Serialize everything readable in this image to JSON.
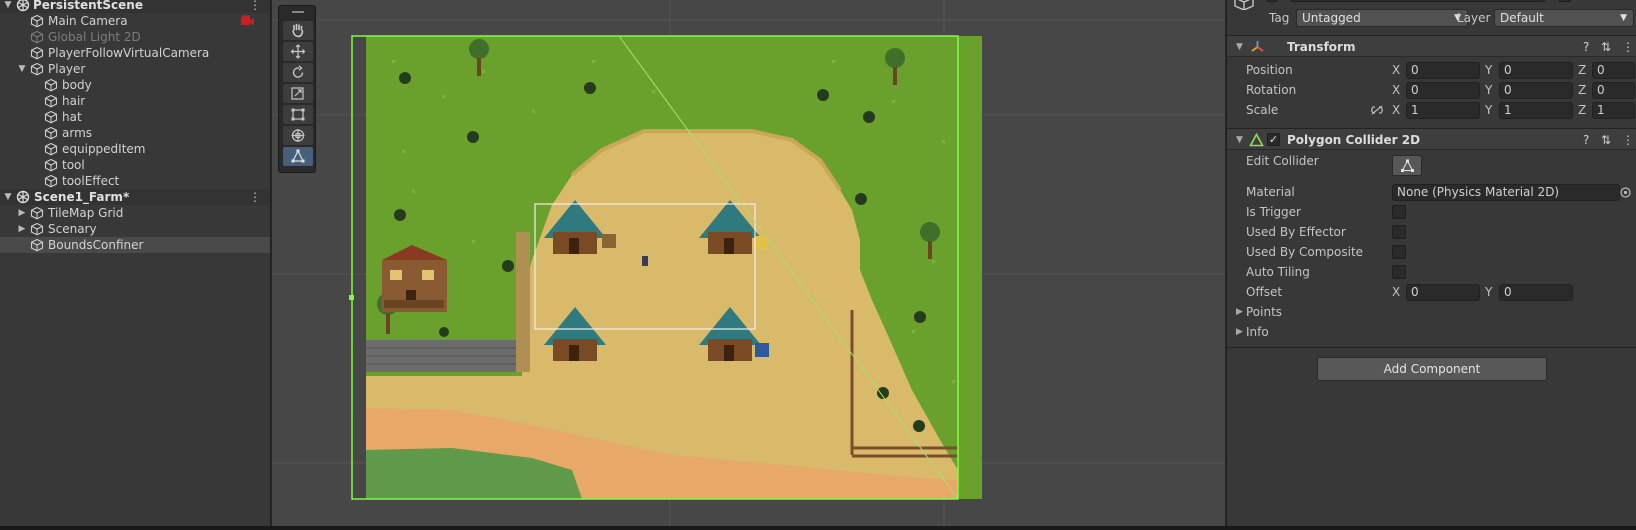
{
  "hierarchy": {
    "persistent_scene": "PersistentScene",
    "main_camera": "Main Camera",
    "global_light": "Global Light 2D",
    "follow_camera": "PlayerFollowVirtualCamera",
    "player": "Player",
    "body": "body",
    "hair": "hair",
    "hat": "hat",
    "arms": "arms",
    "equipped_item": "equippedItem",
    "tool": "tool",
    "tool_effect": "toolEffect",
    "scene1": "Scene1_Farm*",
    "tilemap_grid": "TileMap Grid",
    "scenary": "Scenary",
    "bounds_confiner": "BoundsConfiner",
    "kebab": "⋮"
  },
  "scene_tools": {
    "icons": [
      "hand-icon",
      "move-icon",
      "rotate-icon",
      "scale-icon",
      "rect-icon",
      "transform-icon",
      "edit-collider-icon"
    ]
  },
  "inspector": {
    "tag_label": "Tag",
    "tag_value": "Untagged",
    "layer_label": "Layer",
    "layer_value": "Default",
    "transform": {
      "title": "Transform",
      "position_label": "Position",
      "rotation_label": "Rotation",
      "scale_label": "Scale",
      "x": "X",
      "y": "Y",
      "z": "Z",
      "position": [
        "0",
        "0",
        "0"
      ],
      "rotation": [
        "0",
        "0",
        "0"
      ],
      "scale": [
        "1",
        "1",
        "1"
      ]
    },
    "collider": {
      "title": "Polygon Collider 2D",
      "edit_collider_label": "Edit Collider",
      "material_label": "Material",
      "material_value": "None (Physics Material 2D)",
      "is_trigger_label": "Is Trigger",
      "used_by_effector_label": "Used By Effector",
      "used_by_composite_label": "Used By Composite",
      "auto_tiling_label": "Auto Tiling",
      "offset_label": "Offset",
      "offset": [
        "0",
        "0"
      ],
      "points_label": "Points",
      "info_label": "Info"
    },
    "add_component": "Add Component"
  },
  "colors": {
    "grass": "#6aa02c",
    "sand": "#d9b96a",
    "collider_outline": "#7cff3f",
    "selection": "#4a4a4a"
  }
}
